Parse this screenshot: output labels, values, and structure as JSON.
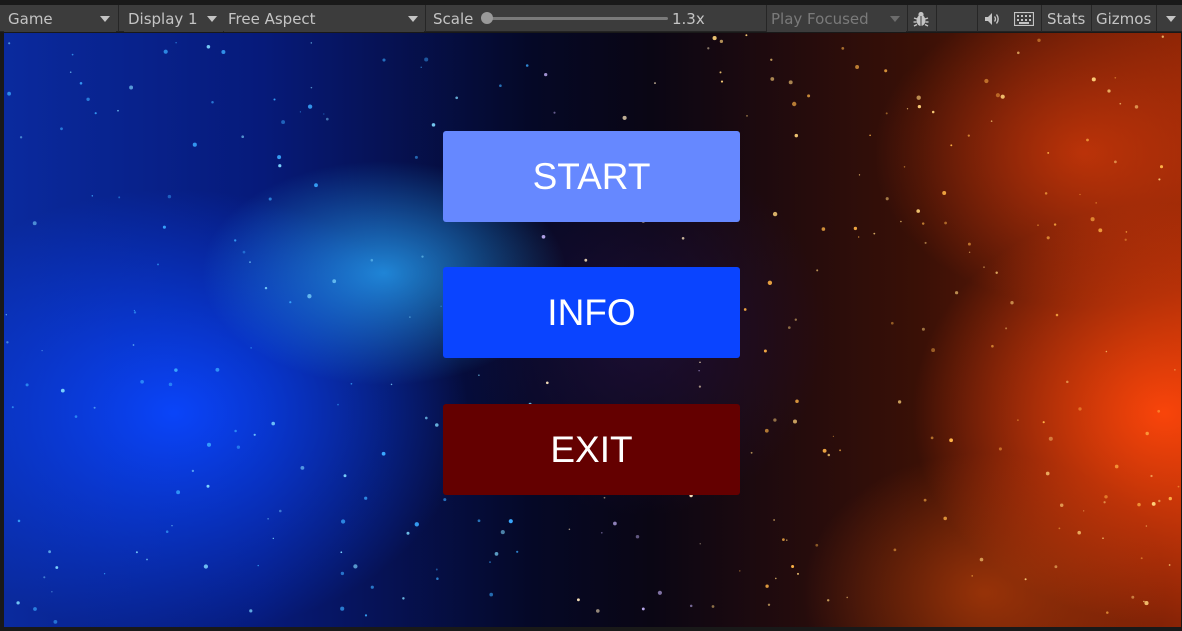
{
  "toolbar": {
    "view_tab": "Game",
    "display": "Display 1",
    "aspect": "Free Aspect",
    "scale_label": "Scale",
    "scale_value": "1.3x",
    "scale_fraction": 0.0,
    "play_mode": "Play Focused",
    "stats_label": "Stats",
    "gizmos_label": "Gizmos",
    "icons": {
      "debug": "bug-icon",
      "audio": "speaker-icon",
      "keyboard": "keyboard-icon"
    }
  },
  "menu": {
    "start": {
      "label": "START",
      "color": "#6688ff"
    },
    "info": {
      "label": "INFO",
      "color": "#0a44ff"
    },
    "exit": {
      "label": "EXIT",
      "color": "#640000"
    }
  }
}
